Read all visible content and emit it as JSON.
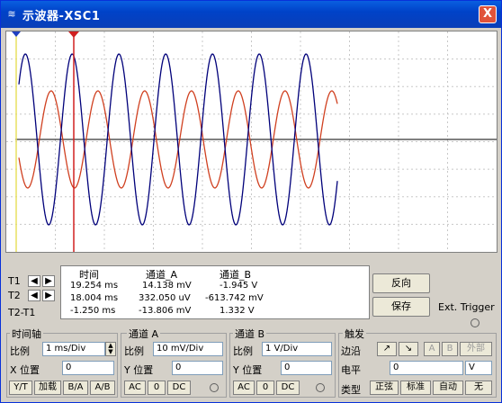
{
  "window": {
    "title": "示波器-XSC1",
    "close_label": "X"
  },
  "cursors": {
    "t1_label": "T1",
    "t2_label": "T2",
    "diff_label": "T2-T1"
  },
  "readout": {
    "headers": [
      "时间",
      "通道_A",
      "通道_B"
    ],
    "rows": [
      [
        "19.254 ms",
        "14.138 mV",
        "-1.945 V"
      ],
      [
        "18.004 ms",
        "332.050 uV",
        "-613.742 mV"
      ],
      [
        "-1.250 ms",
        "-13.806 mV",
        "1.332 V"
      ]
    ]
  },
  "buttons": {
    "reverse": "反向",
    "save": "保存"
  },
  "ext_trigger": "Ext. Trigger",
  "timebase": {
    "title": "时间轴",
    "scale_label": "比例",
    "scale_value": "1 ms/Div",
    "xpos_label": "X 位置",
    "xpos_value": "0",
    "modes": [
      "Y/T",
      "加载",
      "B/A",
      "A/B"
    ]
  },
  "channel_a": {
    "title": "通道 A",
    "scale_label": "比例",
    "scale_value": "10 mV/Div",
    "ypos_label": "Y 位置",
    "ypos_value": "0",
    "coupling": [
      "AC",
      "0",
      "DC"
    ]
  },
  "channel_b": {
    "title": "通道 B",
    "scale_label": "比例",
    "scale_value": "1 V/Div",
    "ypos_label": "Y 位置",
    "ypos_value": "0",
    "coupling": [
      "AC",
      "0",
      "DC"
    ]
  },
  "trigger": {
    "title": "触发",
    "edge_label": "边沿",
    "level_label": "电平",
    "level_value": "0",
    "level_unit": "V",
    "edge_buttons": [
      "↗",
      "↘",
      "A",
      "B",
      "外部"
    ],
    "type_label": "类型",
    "type_buttons": [
      "正弦",
      "标准",
      "自动",
      "无"
    ]
  },
  "colors": {
    "channel_a": "#d04020",
    "channel_b": "#00007a",
    "cursor1": "#2040c0",
    "cursor2": "#d02020"
  }
}
